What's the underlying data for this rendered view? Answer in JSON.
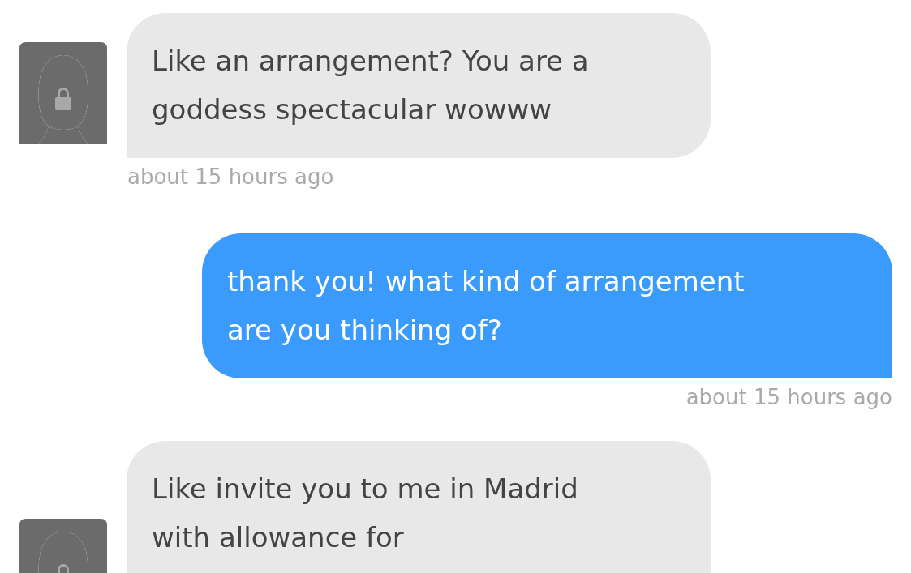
{
  "messages": [
    {
      "kind": "incoming",
      "text": "Like an arrangement? You are a\ngoddess spectacular wowww",
      "time": "about 15 hours ago"
    },
    {
      "kind": "outgoing",
      "text": "thank you! what kind of arrangement\nare you thinking of?",
      "time": "about 15 hours ago"
    },
    {
      "kind": "incoming",
      "text": "Like invite you to me in Madrid\nwith allowance for"
    }
  ]
}
